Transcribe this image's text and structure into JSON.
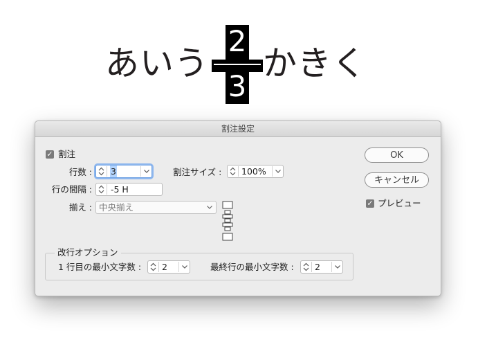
{
  "sample": {
    "left_text": "あいう",
    "warichu_top": "2",
    "warichu_bottom": "3",
    "right_text": "かきく"
  },
  "dialog": {
    "title": "割注設定",
    "warichu_checkbox_label": "割注",
    "warichu_checked": true,
    "lines_label": "行数 :",
    "lines_value": "3",
    "size_label": "割注サイズ :",
    "size_value": "100%",
    "line_spacing_label": "行の間隔 :",
    "line_spacing_value": "-5 H",
    "alignment_label": "揃え :",
    "alignment_value": "中央揃え",
    "break_options_title": "改行オプション",
    "min_chars_first_label": "1 行目の最小文字数 :",
    "min_chars_first_value": "2",
    "min_chars_last_label": "最終行の最小文字数 :",
    "min_chars_last_value": "2",
    "ok_label": "OK",
    "cancel_label": "キャンセル",
    "preview_label": "プレビュー",
    "preview_checked": true
  },
  "colors": {
    "dialog_bg": "#ececec",
    "focus_ring": "#8eb7ee",
    "selection": "#b3d4fd",
    "checkbox": "#7a7a7a"
  },
  "icons": [
    "checkmark-icon",
    "stepper-icon",
    "chevron-down-icon",
    "center-align-icon"
  ]
}
